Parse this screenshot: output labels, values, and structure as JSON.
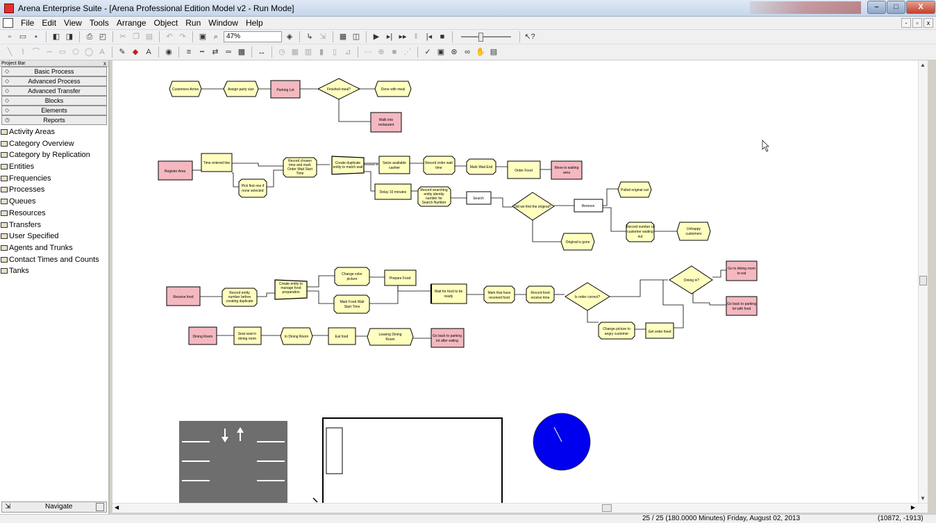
{
  "window": {
    "title": "Arena Enterprise Suite - [Arena Professional Edition Model v2 - Run Mode]",
    "min_glyph": "–",
    "max_glyph": "□",
    "close_glyph": "X"
  },
  "menu": {
    "items": [
      "File",
      "Edit",
      "View",
      "Tools",
      "Arrange",
      "Object",
      "Run",
      "Window",
      "Help"
    ],
    "mdi": [
      "-",
      "▫",
      "x"
    ]
  },
  "toolbar": {
    "zoom": "47%"
  },
  "project_bar": {
    "title": "Project Bar",
    "close": "x",
    "panels": [
      "Basic Process",
      "Advanced Process",
      "Advanced Transfer",
      "Blocks",
      "Elements",
      "Reports"
    ],
    "report_items": [
      "Activity Areas",
      "Category Overview",
      "Category by Replication",
      "Entities",
      "Frequencies",
      "Processes",
      "Queues",
      "Resources",
      "Transfers",
      "User Specified",
      "Agents and Trunks",
      "Contact Times and Counts",
      "Tanks"
    ],
    "navigate": "Navigate"
  },
  "model": {
    "row1": {
      "customers_arrive": "Customers Arrive",
      "assign_party_size": "Assign party size",
      "parking_lot": "Parking Lot",
      "finished_meal": "Finished meal?",
      "done_with_meal": "Done with meal",
      "walk_into_restaurant_1": "Walk into",
      "walk_into_restaurant_2": "restaurant"
    },
    "row2": {
      "register_area": "Register Area",
      "time_entered_line": "Time entered line",
      "pick_first_1": "Pick first one if",
      "pick_first_2": "none selected",
      "record_chosen_1": "Record chosen",
      "record_chosen_2": "time and mark",
      "record_chosen_3": "Order Wait Start",
      "record_chosen_4": "Time",
      "create_dup_1": "Create duplicate",
      "create_dup_2": "entity to match wait",
      "seize_cashier_1": "Seize available",
      "seize_cashier_2": "cashier",
      "record_order_1": "Record order wait",
      "record_order_2": "time",
      "mark_wait_end": "Mark Wait End",
      "order_food": "Order Food",
      "move_waiting_1": "Move to waiting",
      "move_waiting_2": "area",
      "delay_10": "Delay 10 minutes",
      "record_search_1": "Record searching",
      "record_search_2": "entity identity",
      "record_search_3": "number for",
      "record_search_4": "Search Number",
      "search": "Search",
      "did_we_find": "Did we find the original?",
      "remove": "Remove",
      "pulled_original": "Pulled original out",
      "record_number_1": "Record number of",
      "record_number_2": "customer waiting",
      "record_number_3": "out",
      "unhappy_1": "Unhappy",
      "unhappy_2": "customers",
      "original_gone": "Original is gone"
    },
    "row3": {
      "receive_food": "Receive food",
      "record_entity_1": "Record entity",
      "record_entity_2": "number before",
      "record_entity_3": "creating duplicate",
      "create_entity_1": "Create entity to",
      "create_entity_2": "manage food",
      "create_entity_3": "preparation",
      "change_color_1": "Change color",
      "change_color_2": "picture",
      "prepare_food": "Prepare Food",
      "mark_food_1": "Mark Food Wait",
      "mark_food_2": "Start Time",
      "wait_food_1": "Wait for food to be",
      "wait_food_2": "ready",
      "mark_received_1": "Mark that have",
      "mark_received_2": "received food",
      "record_food_1": "Record food",
      "record_food_2": "receive time",
      "is_order_correct": "Is order correct?",
      "dining_in": "Dining in?",
      "go_dining_1": "Go to dining room",
      "go_dining_2": "to eat",
      "go_parking_1": "Go back to parking",
      "go_parking_2": "lot with food",
      "change_angry_1": "Change picture to",
      "change_angry_2": "angry customer",
      "get_order_fixed": "Get order fixed"
    },
    "row4": {
      "dining_room": "Dining Room",
      "seat_1": "Seat seat in",
      "seat_2": "dining room",
      "in_dining_room": "In Dining Room",
      "eat_food": "Eat food",
      "leaving_1": "Leaving Dining",
      "leaving_2": "Room",
      "go_back_1": "Go back to parking",
      "go_back_2": "lot after eating"
    }
  },
  "status": {
    "left": "25 / 25  (180.0000 Minutes) Friday, August 02, 2013",
    "coords": "(10872, -1913)"
  },
  "colors": {
    "process_fill": "#ffffc0",
    "io_fill": "#f4b8c0",
    "pie_fill": "#0000ee"
  }
}
